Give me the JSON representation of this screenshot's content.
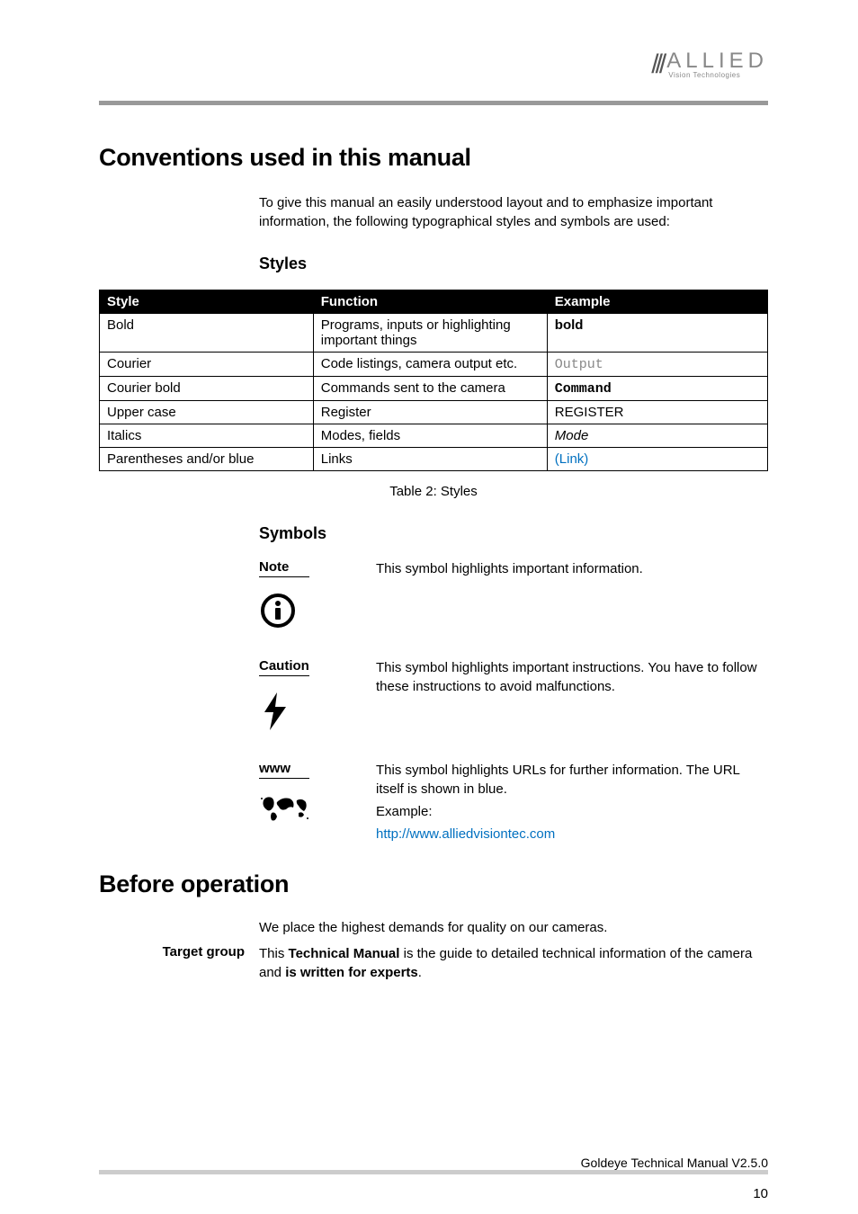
{
  "logo": {
    "main": "ALLIED",
    "sub": "Vision Technologies"
  },
  "h1_conventions": "Conventions used in this manual",
  "intro": "To give this manual an easily understood layout and to emphasize important information, the following typographical styles and symbols are used:",
  "h2_styles": "Styles",
  "table": {
    "headers": {
      "style": "Style",
      "function": "Function",
      "example": "Example"
    },
    "rows": [
      {
        "style": "Bold",
        "function": "Programs, inputs or highlighting important things",
        "example": "bold"
      },
      {
        "style": "Courier",
        "function": "Code listings, camera output etc.",
        "example": "Output"
      },
      {
        "style": "Courier bold",
        "function": "Commands sent to the camera",
        "example": "Command"
      },
      {
        "style": "Upper case",
        "function": "Register",
        "example": "REGISTER"
      },
      {
        "style": "Italics",
        "function": "Modes, fields",
        "example": "Mode"
      },
      {
        "style": "Parentheses and/or blue",
        "function": "Links",
        "example": "(Link)"
      }
    ]
  },
  "caption": "Table 2: Styles",
  "h2_symbols": "Symbols",
  "symbols": {
    "note": {
      "label": "Note",
      "text": "This symbol highlights important information."
    },
    "caution": {
      "label": "Caution",
      "text": "This symbol highlights important instructions. You have to follow these instructions to avoid malfunctions."
    },
    "www": {
      "label": "www",
      "text1": "This symbol highlights URLs for further information. The URL itself is shown in blue.",
      "text2": "Example:",
      "link": "http://www.alliedvisiontec.com"
    }
  },
  "h1_before": "Before operation",
  "before_intro": "We place the highest demands for quality on our cameras.",
  "target": {
    "label": "Target group",
    "text_pre": "This ",
    "text_bold1": "Technical Manual",
    "text_mid": " is the guide to detailed technical information of the camera and ",
    "text_bold2": "is written for experts",
    "text_post": "."
  },
  "footer": "Goldeye Technical Manual V2.5.0",
  "page": "10"
}
